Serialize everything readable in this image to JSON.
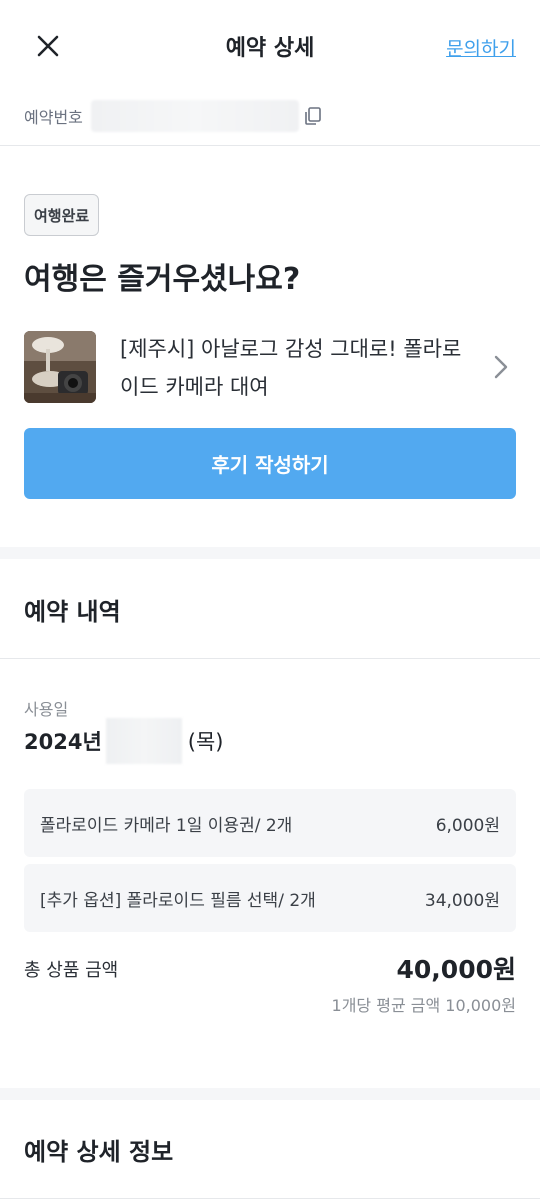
{
  "header": {
    "title": "예약 상세",
    "inquiry_label": "문의하기"
  },
  "reservation": {
    "number_label": "예약번호"
  },
  "status": {
    "badge": "여행완료",
    "headline": "여행은 즐거우셨나요?"
  },
  "product": {
    "name": "[제주시] 아날로그 감성 그대로! 폴라로이드 카메라 대여"
  },
  "review_button_label": "후기 작성하기",
  "details": {
    "section_title": "예약 내역",
    "use_date_label": "사용일",
    "use_date_year": "2024년",
    "use_date_day": "(목)",
    "items": [
      {
        "name": "폴라로이드 카메라 1일 이용권/ 2개",
        "price": "6,000원"
      },
      {
        "name": "[추가 옵션] 폴라로이드 필름 선택/ 2개",
        "price": "34,000원"
      }
    ],
    "total_label": "총 상품 금액",
    "total_value": "40,000원",
    "avg_text": "1개당 평균 금액 10,000원"
  },
  "info": {
    "section_title": "예약 상세 정보"
  },
  "colors": {
    "accent": "#52a9f0",
    "link": "#3fa0ec"
  }
}
